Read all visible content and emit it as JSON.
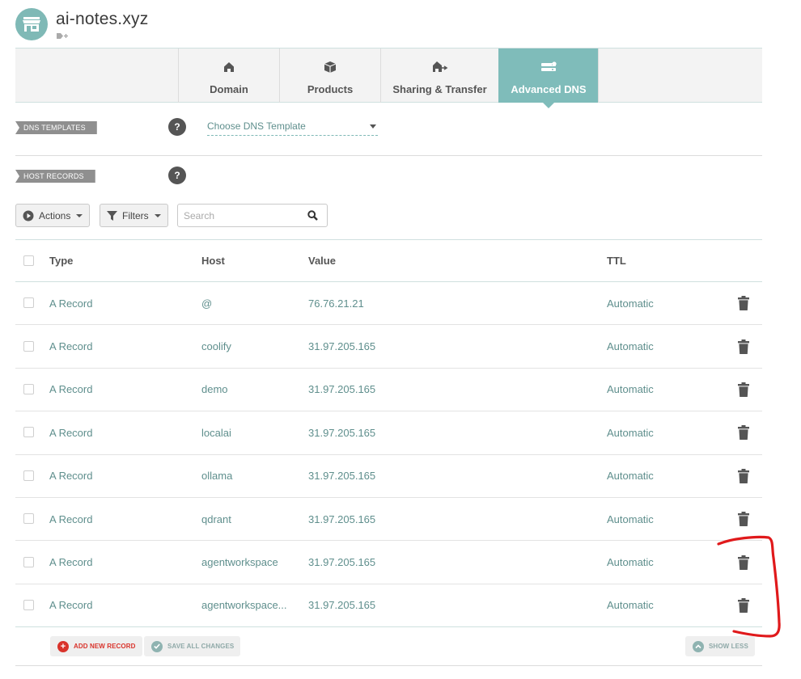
{
  "domain": {
    "name": "ai-notes.xyz"
  },
  "tabs": [
    {
      "label": "Domain",
      "icon": "home-icon",
      "active": false
    },
    {
      "label": "Products",
      "icon": "box-icon",
      "active": false
    },
    {
      "label": "Sharing & Transfer",
      "icon": "transfer-icon",
      "active": false
    },
    {
      "label": "Advanced DNS",
      "icon": "server-icon",
      "active": true
    }
  ],
  "dns_templates": {
    "label": "DNS TEMPLATES",
    "help": "?",
    "select_value": "Choose DNS Template"
  },
  "host_records": {
    "label": "HOST RECORDS",
    "help": "?"
  },
  "toolbar": {
    "actions_label": "Actions",
    "filters_label": "Filters",
    "search_placeholder": "Search"
  },
  "table": {
    "headers": {
      "type": "Type",
      "host": "Host",
      "value": "Value",
      "ttl": "TTL"
    },
    "rows": [
      {
        "type": "A Record",
        "host": "@",
        "value": "76.76.21.21",
        "ttl": "Automatic"
      },
      {
        "type": "A Record",
        "host": "coolify",
        "value": "31.97.205.165",
        "ttl": "Automatic"
      },
      {
        "type": "A Record",
        "host": "demo",
        "value": "31.97.205.165",
        "ttl": "Automatic"
      },
      {
        "type": "A Record",
        "host": "localai",
        "value": "31.97.205.165",
        "ttl": "Automatic"
      },
      {
        "type": "A Record",
        "host": "ollama",
        "value": "31.97.205.165",
        "ttl": "Automatic"
      },
      {
        "type": "A Record",
        "host": "qdrant",
        "value": "31.97.205.165",
        "ttl": "Automatic"
      },
      {
        "type": "A Record",
        "host": "agentworkspace",
        "value": "31.97.205.165",
        "ttl": "Automatic"
      },
      {
        "type": "A Record",
        "host": "agentworkspace...",
        "value": "31.97.205.165",
        "ttl": "Automatic"
      }
    ]
  },
  "footer": {
    "add_label": "ADD NEW RECORD",
    "save_label": "SAVE ALL CHANGES",
    "show_less_label": "SHOW LESS"
  },
  "colors": {
    "accent": "#7fbcba",
    "link": "#5f8f8d",
    "danger": "#d9332b",
    "annotation": "#e0191b"
  }
}
